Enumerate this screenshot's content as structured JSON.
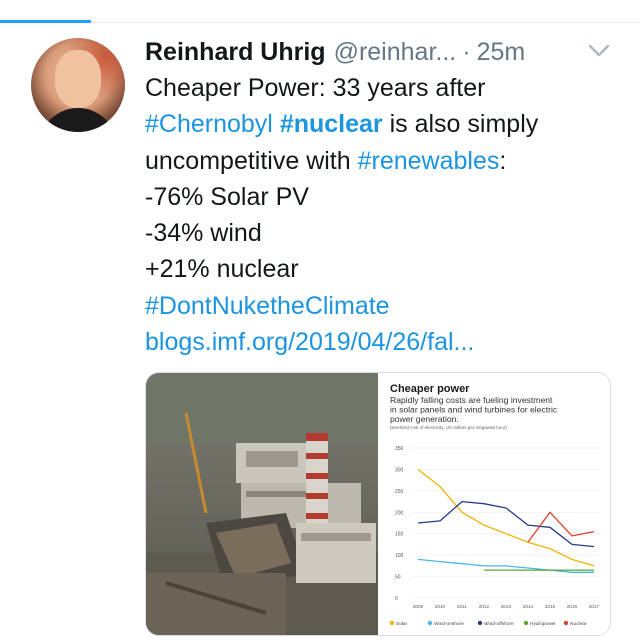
{
  "tab_indicator": {
    "active": true
  },
  "tweet": {
    "author_name": "Reinhard Uhrig",
    "handle": "@reinhar...",
    "separator": "·",
    "time": "25m",
    "lines": [
      [
        {
          "t": "Cheaper Power: 33 years after",
          "k": "text"
        }
      ],
      [
        {
          "t": "#Chernobyl",
          "k": "tag"
        },
        {
          "t": " ",
          "k": "text"
        },
        {
          "t": "#nuclear",
          "k": "tagbold"
        },
        {
          "t": " is also simply",
          "k": "text"
        }
      ],
      [
        {
          "t": "uncompetitive with ",
          "k": "text"
        },
        {
          "t": "#renewables",
          "k": "tag"
        },
        {
          "t": ":",
          "k": "text"
        }
      ],
      [
        {
          "t": "-76% Solar PV",
          "k": "text"
        }
      ],
      [
        {
          "t": "-34% wind",
          "k": "text"
        }
      ],
      [
        {
          "t": "+21% nuclear",
          "k": "text"
        }
      ],
      [
        {
          "t": "#DontNuketheClimate",
          "k": "tag"
        }
      ],
      [
        {
          "t": "blogs.imf.org/2019/04/26/fal...",
          "k": "link"
        }
      ]
    ]
  },
  "chart_data": {
    "type": "line",
    "title": "Cheaper power",
    "subtitle": "Rapidly falling costs are fueling investment in solar panels and wind turbines for electric power generation.",
    "ylabel": "(levelized cost of electricity, US dollars per megawatt hour)",
    "x": [
      "2009",
      "2010",
      "2011",
      "2012",
      "2013",
      "2014",
      "2015",
      "2016",
      "2017"
    ],
    "yticks": [
      0,
      50,
      100,
      150,
      200,
      250,
      300,
      350
    ],
    "ylim": [
      0,
      350
    ],
    "series": [
      {
        "name": "Solar",
        "color": "#f2b400",
        "values": [
          300,
          260,
          200,
          170,
          150,
          130,
          115,
          90,
          75
        ]
      },
      {
        "name": "Wind-onshore",
        "color": "#4ab6e8",
        "values": [
          90,
          85,
          80,
          75,
          75,
          70,
          65,
          60,
          60
        ]
      },
      {
        "name": "Wind-offshore",
        "color": "#253a8c",
        "values": [
          175,
          180,
          225,
          220,
          210,
          170,
          165,
          125,
          120
        ]
      },
      {
        "name": "Hydropower",
        "color": "#5aa832",
        "values": [
          null,
          null,
          null,
          65,
          65,
          65,
          65,
          65,
          65
        ]
      },
      {
        "name": "Nuclear",
        "color": "#e0402e",
        "values": [
          null,
          null,
          null,
          null,
          null,
          130,
          200,
          145,
          155
        ]
      }
    ]
  }
}
